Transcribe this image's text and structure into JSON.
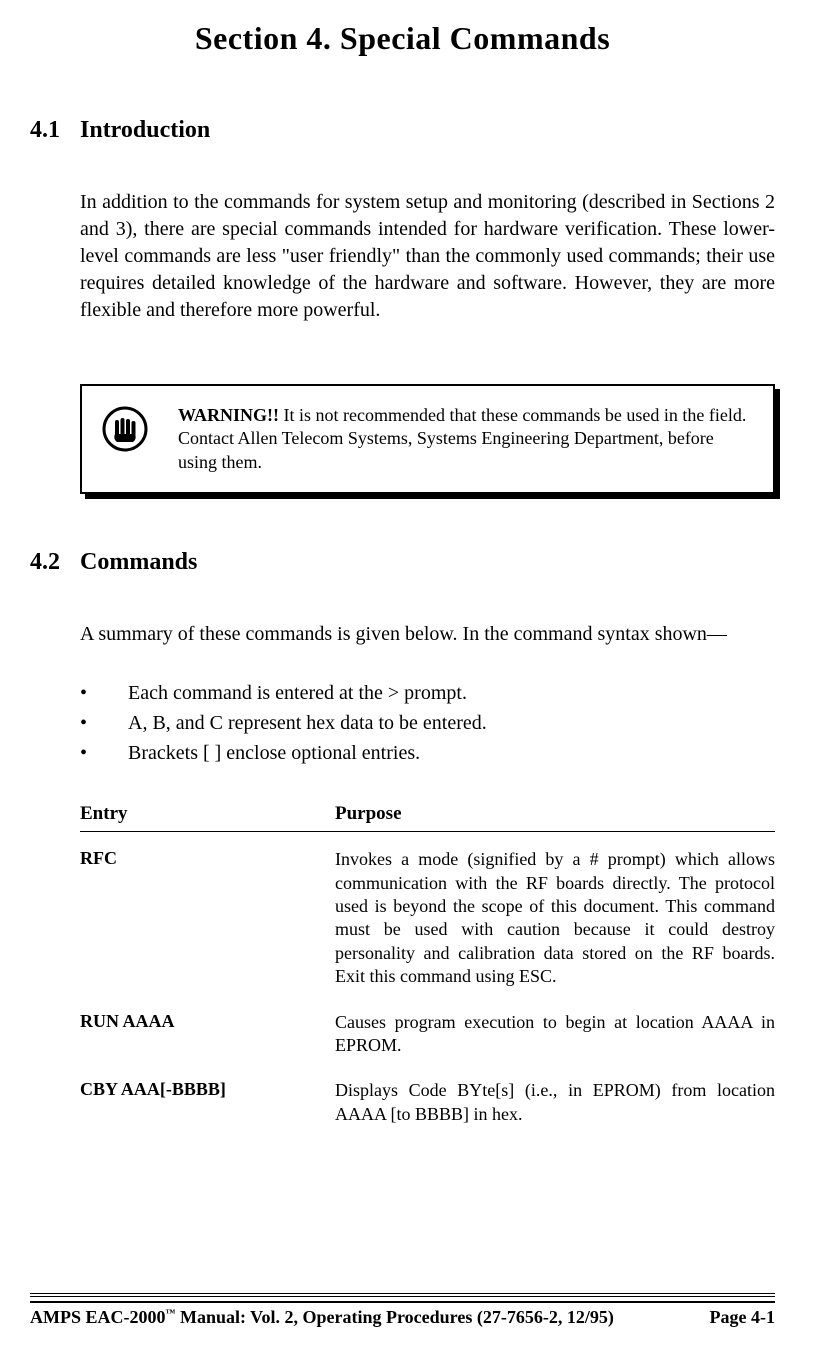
{
  "title": "Section 4.  Special Commands",
  "sections": {
    "intro": {
      "num": "4.1",
      "heading": "Introduction",
      "body": "In addition to the commands for system setup and monitoring (described in Sections 2 and 3), there are special commands intended for hardware verification.  These lower-level commands are less \"user friendly\" than the commonly used commands;  their use requires detailed knowledge of the hardware and software.  However, they are more flexible and therefore more powerful."
    },
    "warning": {
      "label": "WARNING!!",
      "text": "  It is not recommended that these commands be used in the field.  Contact Allen Telecom Systems, Systems Engineering Department, before using them."
    },
    "commands": {
      "num": "4.2",
      "heading": "Commands",
      "intro": "A summary of these commands is given below.  In the command syntax shown—",
      "bullets": [
        "Each command is entered at the > prompt.",
        "A, B, and C represent hex data to be entered.",
        "Brackets [ ] enclose optional entries."
      ],
      "table": {
        "headers": {
          "entry": "Entry",
          "purpose": "Purpose"
        },
        "rows": [
          {
            "entry": "RFC",
            "purpose": "Invokes a mode (signified by a # prompt) which allows communication with the RF boards directly.  The protocol used is beyond the scope of this document.  This command must be used with caution because it could destroy personality and calibration data stored on the RF boards.  Exit this command using ESC."
          },
          {
            "entry": "RUN AAAA",
            "purpose": "Causes program execution to begin at location AAAA in EPROM."
          },
          {
            "entry": "CBY AAA[-BBBB]",
            "purpose": "Displays Code BYte[s] (i.e., in EPROM) from location AAAA [to BBBB] in hex."
          }
        ]
      }
    }
  },
  "footer": {
    "left_prefix": "AMPS EAC-2000",
    "left_suffix": " Manual:  Vol. 2, Operating Procedures (27-7656-2, 12/95)",
    "right": "Page 4-1"
  }
}
